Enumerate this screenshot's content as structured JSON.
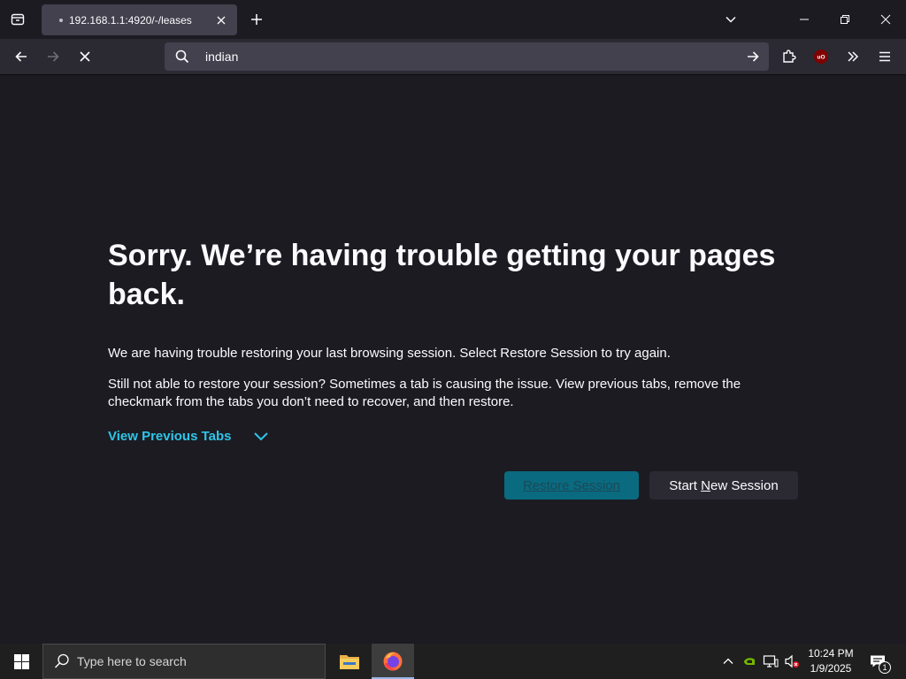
{
  "browser": {
    "tab": {
      "title": "192.168.1.1:4920/-/leases"
    },
    "urlbar": {
      "value": "indian"
    }
  },
  "page": {
    "heading": "Sorry. We’re having trouble getting your pages back.",
    "paragraph_1": "We are having trouble restoring your last browsing session. Select Restore Session to try again.",
    "paragraph_2": "Still not able to restore your session? Sometimes a tab is causing the issue. View previous tabs, remove the checkmark from the tabs you don’t need to recover, and then restore.",
    "view_previous_tabs": "View Previous Tabs",
    "restore_button": "Restore Session",
    "new_session_prefix": "Start ",
    "new_session_accesskey": "N",
    "new_session_suffix": "ew Session",
    "accent_color": "#2fc5e8"
  },
  "taskbar": {
    "search_placeholder": "Type here to search",
    "time": "10:24 PM",
    "date": "1/9/2025",
    "notification_count": "1"
  }
}
